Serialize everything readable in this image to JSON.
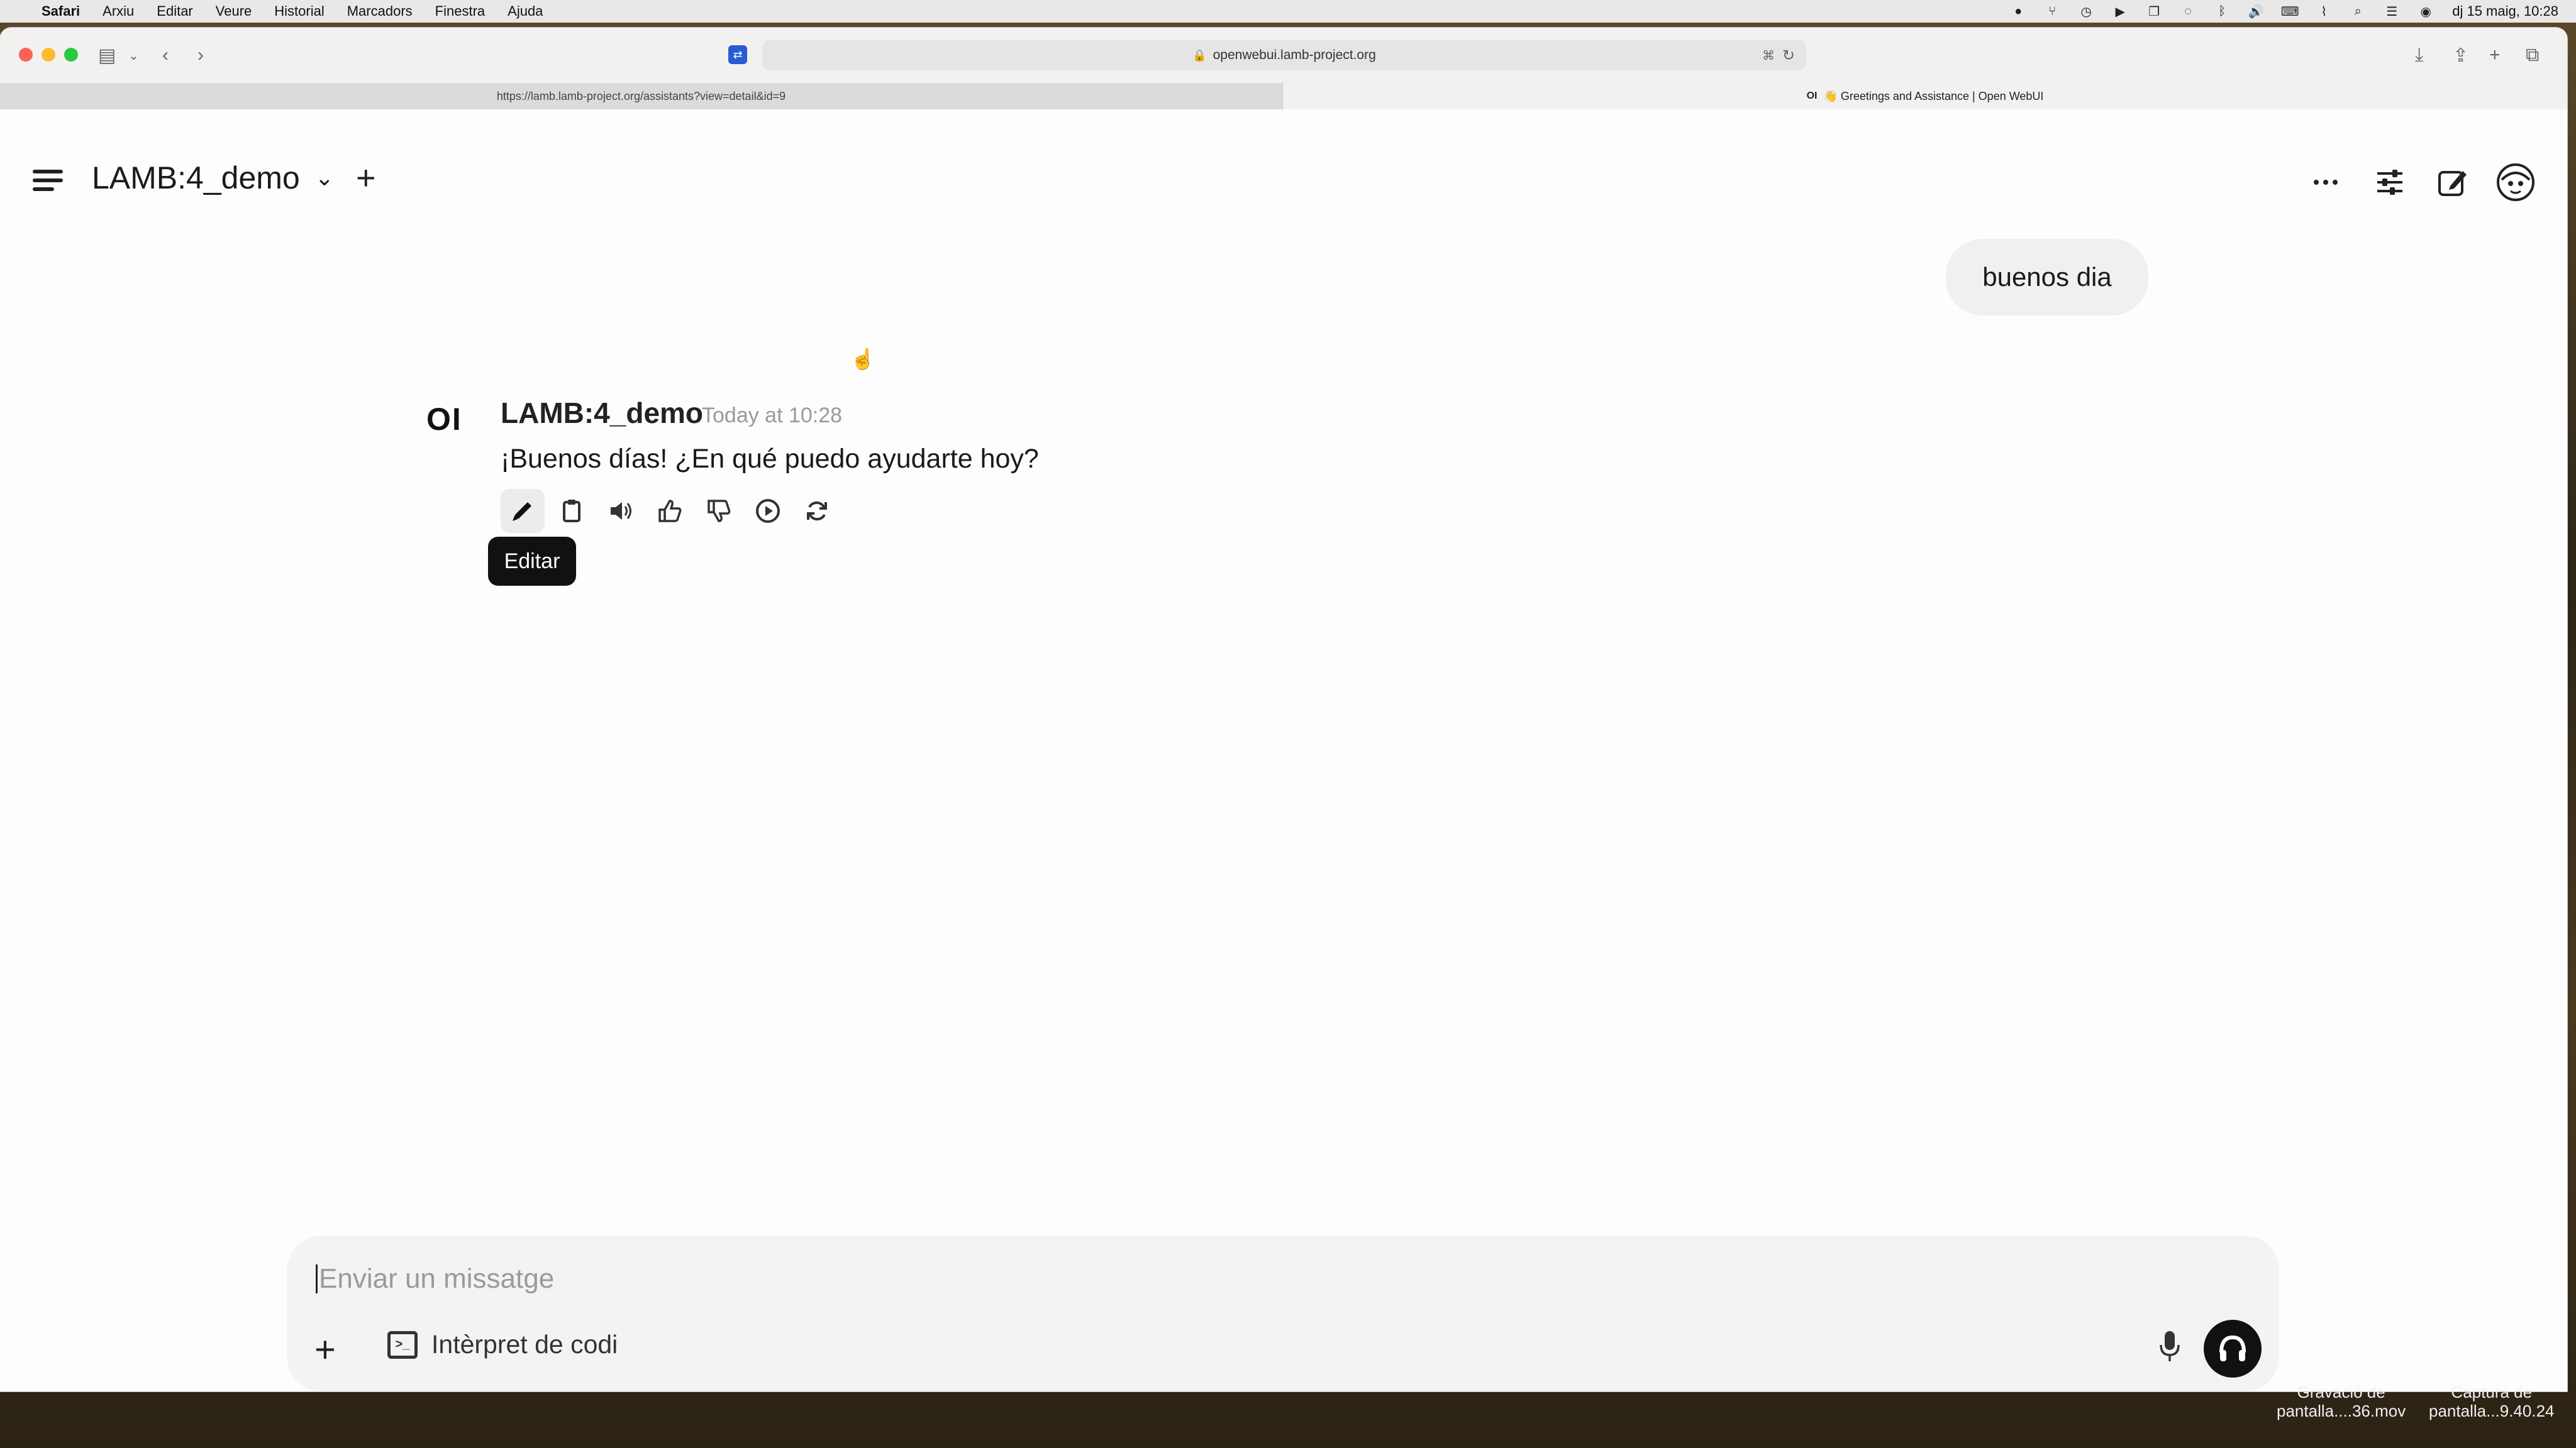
{
  "menubar": {
    "app": "Safari",
    "items": [
      "Arxiu",
      "Editar",
      "Veure",
      "Historial",
      "Marcadors",
      "Finestra",
      "Ajuda"
    ],
    "clock": "dj 15 maig, 10:28"
  },
  "browser": {
    "address": "openwebui.lamb-project.org",
    "tabs": [
      {
        "label": "https://lamb.lamb-project.org/assistants?view=detail&id=9",
        "active": false
      },
      {
        "label": "👋 Greetings and Assistance | Open WebUI",
        "favicon": "OI",
        "active": true
      }
    ]
  },
  "app": {
    "model_name": "LAMB:4_demo",
    "user_message": "buenos dia",
    "assistant": {
      "avatar": "OI",
      "name": "LAMB:4_demo",
      "timestamp": "Today at 10:28",
      "message": "¡Buenos días! ¿En qué puedo ayudarte hoy?",
      "tooltip": "Editar"
    },
    "composer": {
      "placeholder": "Enviar un missatge",
      "code_interpreter_label": "Intèrpret de codi"
    },
    "help": "?"
  },
  "desktop": {
    "files": [
      {
        "line1": "Gravació de",
        "line2": "pantalla....36.mov"
      },
      {
        "line1": "Captura de",
        "line2": "pantalla...9.40.24"
      }
    ]
  },
  "colors": {
    "send_button": "#111111",
    "tooltip_bg": "#111111",
    "user_bubble": "#f0f0f0"
  }
}
